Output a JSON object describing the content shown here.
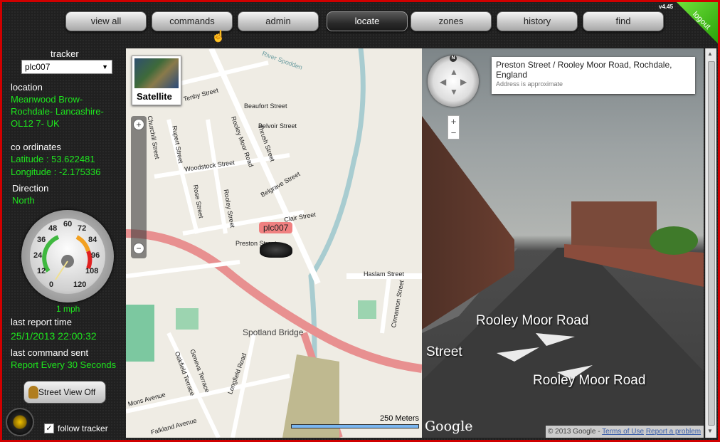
{
  "nav": {
    "items": [
      {
        "label": "view all"
      },
      {
        "label": "commands"
      },
      {
        "label": "admin"
      },
      {
        "label": "locate",
        "active": true
      },
      {
        "label": "zones"
      },
      {
        "label": "history"
      },
      {
        "label": "find"
      }
    ],
    "version": "v4.45",
    "logout": "logout"
  },
  "side": {
    "tracker_label": "tracker",
    "tracker_value": "plc007",
    "location_label": "location",
    "location_lines": [
      "Meanwood Brow-",
      "Rochdale- Lancashire-",
      "OL12 7- UK"
    ],
    "coords_label": "co ordinates",
    "latitude": "Latitude : 53.622481",
    "longitude": "Longitude : -2.175336",
    "direction_label": "Direction",
    "direction": "North",
    "gauge_ticks": [
      "0",
      "12",
      "24",
      "36",
      "48",
      "60",
      "72",
      "84",
      "96",
      "108",
      "120"
    ],
    "speed": "1 mph",
    "speed_value": 1,
    "last_report_label": "last report time",
    "last_report": "25/1/2013 22:00:32",
    "last_command_label": "last command sent",
    "last_command": "Report Every 30 Seconds",
    "street_view_button": "Street View Off",
    "follow_label": "follow tracker",
    "follow_checked": true
  },
  "map": {
    "satellite": "Satellite",
    "streets": [
      "Tenby Street",
      "Beaufort Street",
      "Belvoir Street",
      "Rooley Moor Road",
      "Thrush Street",
      "Rupert Street",
      "Woodstock Street",
      "Belgrave Street",
      "Rose Street",
      "Rooley Street",
      "Clair Street",
      "Preston Street",
      "Haslam Street",
      "Cinnamon Street",
      "Geneva Terrace",
      "Oakfield Terrace",
      "Longfield Road",
      "Mons Avenue",
      "Falkland Avenue",
      "Churchill Street",
      "River Spodden"
    ],
    "place": "Spotland Bridge",
    "marker": "plc007",
    "scale": "250 Meters"
  },
  "streetview": {
    "address": "Preston Street / Rooley Moor Road, Rochdale, England",
    "approx": "Address is approximate",
    "compass_n": "N",
    "nav_labels": [
      "Rooley Moor Road",
      "Street",
      "Rooley Moor Road"
    ],
    "google": "Google",
    "copyright": "© 2013 Google -",
    "terms": "Terms of Use",
    "report": "Report a problem"
  }
}
